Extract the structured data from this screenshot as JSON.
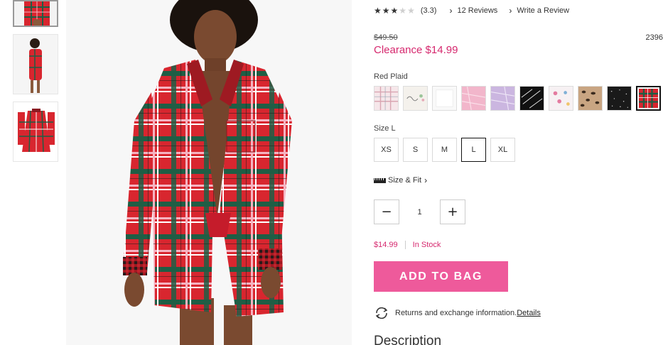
{
  "rating": {
    "stars_filled": 3,
    "stars_total": 5,
    "value_text": "(3.3)",
    "reviews_link": "12 Reviews",
    "write_review_link": "Write a Review"
  },
  "price": {
    "original": "$49.50",
    "clearance": "Clearance $14.99",
    "item_number": "2396"
  },
  "color": {
    "label": "Red Plaid",
    "swatches": [
      "Pink Plaid",
      "Floral Script",
      "White",
      "Pink Sweater",
      "Lilac Sweater",
      "Black Script",
      "Pink Pattern",
      "Leopard",
      "Black Sparkle",
      "Red Plaid"
    ],
    "selected": "Red Plaid"
  },
  "size": {
    "label": "Size L",
    "options": [
      "XS",
      "S",
      "M",
      "L",
      "XL"
    ],
    "selected": "L"
  },
  "size_fit": {
    "label": "Size & Fit"
  },
  "quantity": {
    "value": "1",
    "minus_symbol": "−",
    "plus_symbol": "+"
  },
  "stock": {
    "price": "$14.99",
    "status": "In Stock"
  },
  "add_to_bag": {
    "label": "ADD TO BAG"
  },
  "returns": {
    "text": "Returns and exchange information.",
    "details_link": "Details"
  },
  "description": {
    "heading": "Description"
  },
  "colors": {
    "accent_pink": "#d6286e",
    "button_pink": "#ee5a9b"
  }
}
